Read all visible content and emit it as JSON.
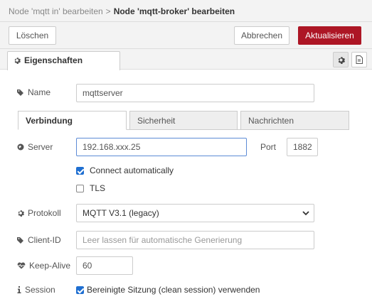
{
  "breadcrumb": {
    "previous": "Node 'mqtt in' bearbeiten",
    "separator": ">",
    "current": "Node 'mqtt-broker' bearbeiten"
  },
  "toolbar": {
    "delete_label": "Löschen",
    "cancel_label": "Abbrechen",
    "update_label": "Aktualisieren"
  },
  "tabs": {
    "properties_label": "Eigenschaften"
  },
  "form": {
    "name": {
      "label": "Name",
      "value": "mqttserver"
    },
    "subtabs": [
      "Verbindung",
      "Sicherheit",
      "Nachrichten"
    ],
    "server": {
      "label": "Server",
      "value": "192.168.xxx.25"
    },
    "port": {
      "label": "Port",
      "value": "1882"
    },
    "connect_auto": {
      "label": "Connect automatically",
      "checked": true
    },
    "tls": {
      "label": "TLS",
      "checked": false
    },
    "protocol": {
      "label": "Protokoll",
      "value": "MQTT V3.1 (legacy)"
    },
    "client_id": {
      "label": "Client-ID",
      "placeholder": "Leer lassen für automatische Generierung"
    },
    "keepalive": {
      "label": "Keep-Alive",
      "value": "60"
    },
    "session": {
      "label": "Session",
      "checkbox_label": "Bereinigte Sitzung (clean session) verwenden",
      "checked": true
    }
  },
  "colors": {
    "primary": "#ad1625",
    "checkbox": "#1f6fd1",
    "focus_border": "#5c8bd6"
  }
}
